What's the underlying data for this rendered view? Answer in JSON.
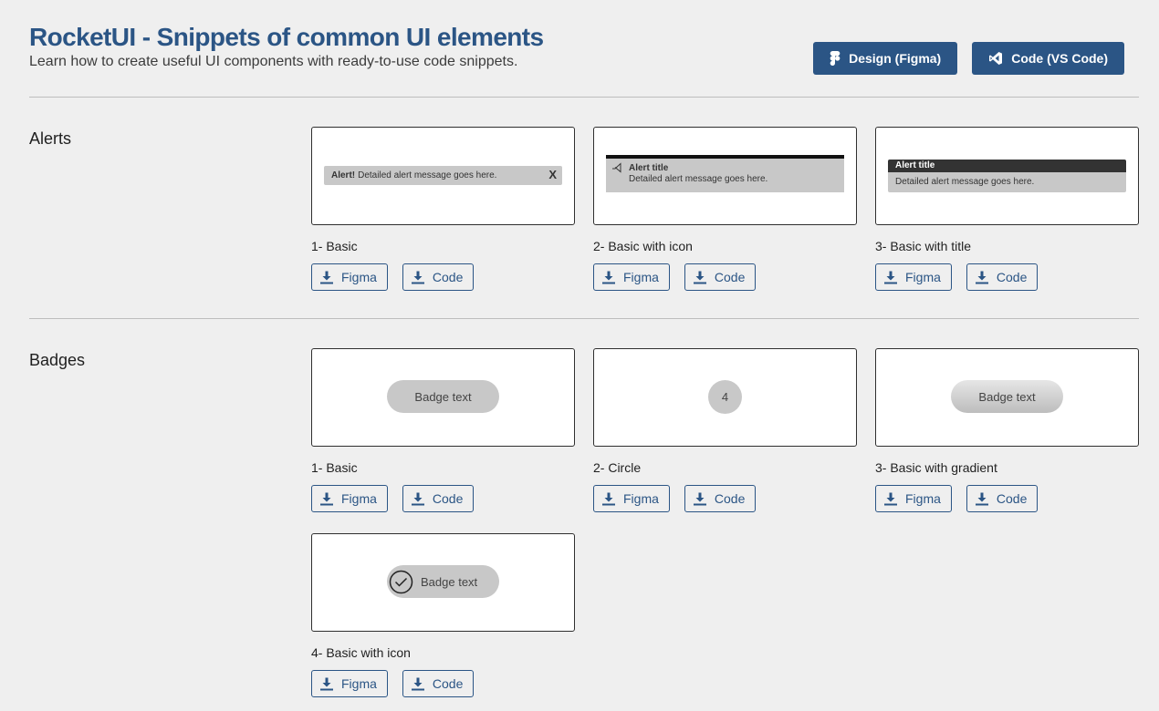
{
  "header": {
    "title": "RocketUI - Snippets of common UI elements",
    "subtitle": "Learn how to create useful UI components with ready-to-use code snippets.",
    "design_button": "Design (Figma)",
    "code_button": "Code (VS Code)"
  },
  "download": {
    "figma": "Figma",
    "code": "Code"
  },
  "alerts": {
    "section_title": "Alerts",
    "cards": [
      {
        "label": "1- Basic",
        "preview": {
          "strong": "Alert!",
          "message": "Detailed alert message goes here.",
          "close": "X"
        }
      },
      {
        "label": "2- Basic with icon",
        "preview": {
          "title": "Alert title",
          "message": "Detailed alert message goes here."
        }
      },
      {
        "label": "3- Basic with title",
        "preview": {
          "title": "Alert title",
          "message": "Detailed alert message goes here."
        }
      }
    ]
  },
  "badges": {
    "section_title": "Badges",
    "cards": [
      {
        "label": "1- Basic",
        "preview": {
          "text": "Badge text"
        }
      },
      {
        "label": "2- Circle",
        "preview": {
          "text": "4"
        }
      },
      {
        "label": "3- Basic with gradient",
        "preview": {
          "text": "Badge text"
        }
      },
      {
        "label": "4- Basic with icon",
        "preview": {
          "text": "Badge text"
        }
      }
    ]
  },
  "colors": {
    "accent": "#2b5585",
    "background": "#efefef",
    "preview_fill": "#c8c8c8"
  }
}
